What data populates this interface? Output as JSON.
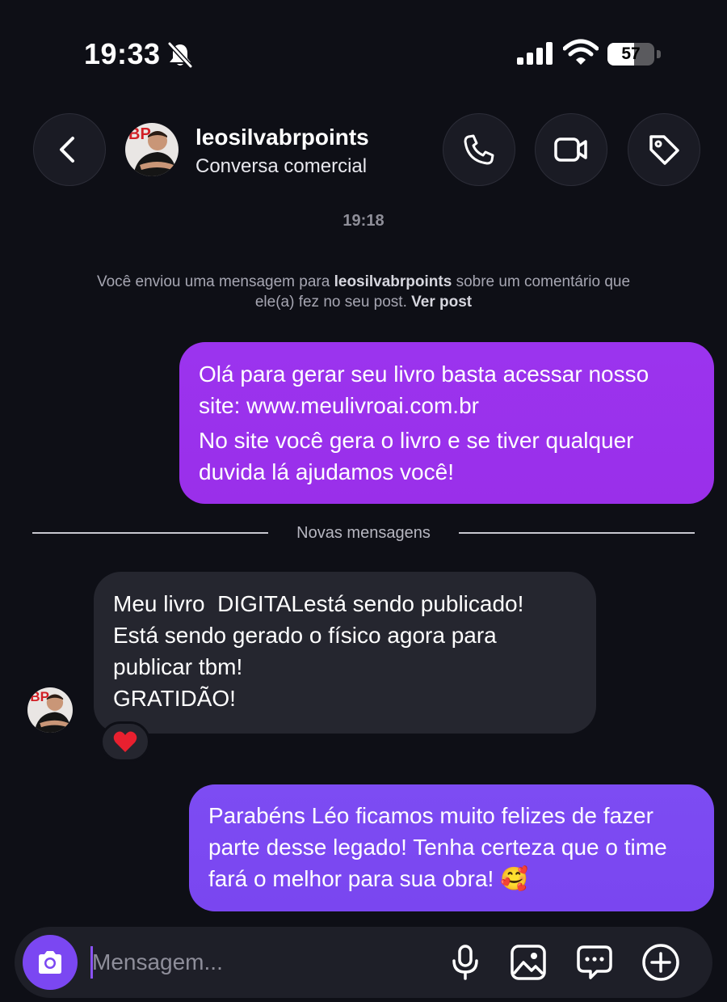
{
  "status_bar": {
    "time": "19:33",
    "battery_percent": "57",
    "battery_level": 0.57,
    "icons": [
      "bell-slash-icon",
      "cellular-signal-icon",
      "wifi-icon",
      "battery-icon"
    ]
  },
  "header": {
    "back_icon": "chevron-left-icon",
    "username": "leosilvabrpoints",
    "subtitle": "Conversa comercial",
    "actions": [
      "phone-icon",
      "video-camera-icon",
      "tag-icon"
    ]
  },
  "thread": {
    "timestamp": "19:18",
    "notice": {
      "prefix": "Você enviou uma mensagem para ",
      "username": "leosilvabrpoints",
      "middle": " sobre um comentário que ele(a) fez no seu post. ",
      "link": "Ver post"
    },
    "outgoing_1": {
      "paragraphs": [
        "Olá para gerar seu livro basta acessar nosso site: www.meulivroai.com.br",
        "No site você gera o livro e se tiver qualquer duvida lá ajudamos você!"
      ]
    },
    "divider_label": "Novas mensagens",
    "incoming_1": {
      "lines": [
        "Meu livro  DIGITALestá sendo publicado!",
        "Está sendo gerado o físico agora para",
        "publicar tbm!",
        "GRATIDÃO!"
      ],
      "reaction": "❤️"
    },
    "outgoing_2": {
      "text": "Parabéns Léo ficamos muito felizes de fazer parte desse legado! Tenha certeza que o time fará o melhor para sua obra! 🥰"
    }
  },
  "composer": {
    "placeholder": "Mensagem...",
    "value": "",
    "icons": [
      "camera-icon",
      "microphone-icon",
      "gallery-icon",
      "chat-bubble-icon",
      "plus-circle-icon"
    ]
  },
  "colors": {
    "background": "#0e0f16",
    "outgoing_bubble_top": "#9b34ee",
    "outgoing_bubble_bottom": "#7d4cf3",
    "incoming_bubble": "#25262f",
    "accent": "#7b47f2"
  }
}
